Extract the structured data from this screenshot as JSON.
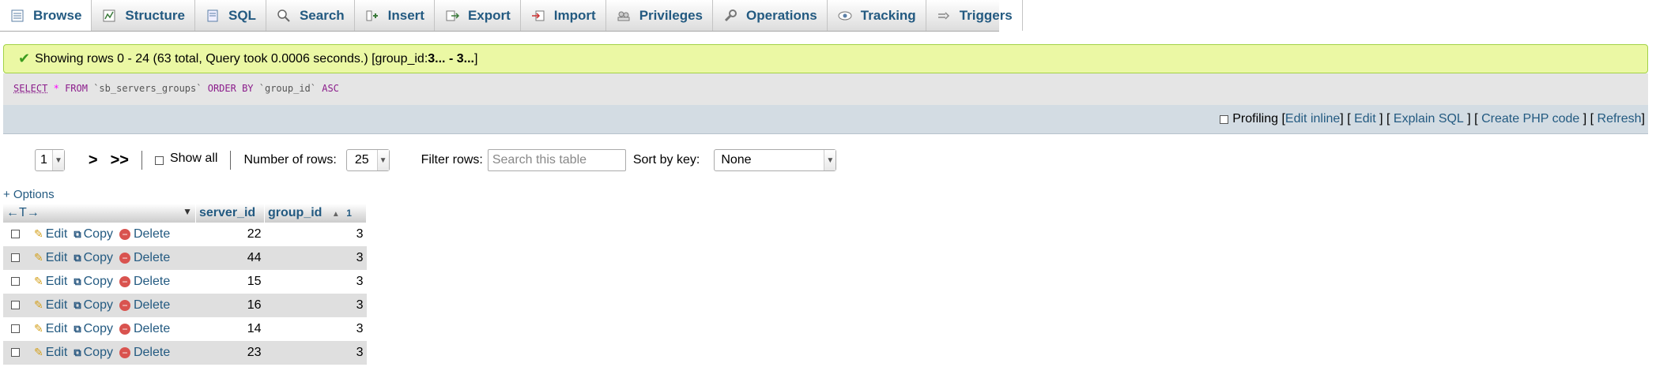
{
  "tabs": [
    {
      "label": "Browse",
      "icon": "browse-icon",
      "active": true
    },
    {
      "label": "Structure",
      "icon": "structure-icon"
    },
    {
      "label": "SQL",
      "icon": "sql-icon"
    },
    {
      "label": "Search",
      "icon": "search-icon"
    },
    {
      "label": "Insert",
      "icon": "insert-icon"
    },
    {
      "label": "Export",
      "icon": "export-icon"
    },
    {
      "label": "Import",
      "icon": "import-icon"
    },
    {
      "label": "Privileges",
      "icon": "privileges-icon"
    },
    {
      "label": "Operations",
      "icon": "operations-icon"
    },
    {
      "label": "Tracking",
      "icon": "tracking-icon"
    },
    {
      "label": "Triggers",
      "icon": "triggers-icon"
    }
  ],
  "success": {
    "text": "Showing rows 0 - 24 (63 total, Query took 0.0006 seconds.) [group_id: ",
    "range_bold": "3... - 3...",
    "close": "]"
  },
  "sql": {
    "select": "SELECT",
    "star": "*",
    "from": "FROM",
    "table": "`sb_servers_groups`",
    "order_by": "ORDER BY",
    "column": "`group_id`",
    "dir": "ASC"
  },
  "tools": {
    "profiling": "Profiling",
    "edit_inline": "Edit inline",
    "edit": "Edit",
    "explain": "Explain SQL",
    "php": "Create PHP code",
    "refresh": "Refresh"
  },
  "nav": {
    "page": "1",
    "next": ">",
    "last": ">>",
    "show_all": "Show all",
    "rows_label": "Number of rows:",
    "rows_value": "25",
    "filter_label": "Filter rows:",
    "filter_placeholder": "Search this table",
    "sort_label": "Sort by key:",
    "sort_value": "None"
  },
  "options": "+ Options",
  "table": {
    "arrows": "←T→",
    "col_server": "server_id",
    "col_group": "group_id",
    "sort_index": "1",
    "edit": "Edit",
    "copy": "Copy",
    "delete": "Delete",
    "rows": [
      {
        "server_id": "22",
        "group_id": "3"
      },
      {
        "server_id": "44",
        "group_id": "3"
      },
      {
        "server_id": "15",
        "group_id": "3"
      },
      {
        "server_id": "16",
        "group_id": "3"
      },
      {
        "server_id": "14",
        "group_id": "3"
      },
      {
        "server_id": "23",
        "group_id": "3"
      }
    ]
  }
}
